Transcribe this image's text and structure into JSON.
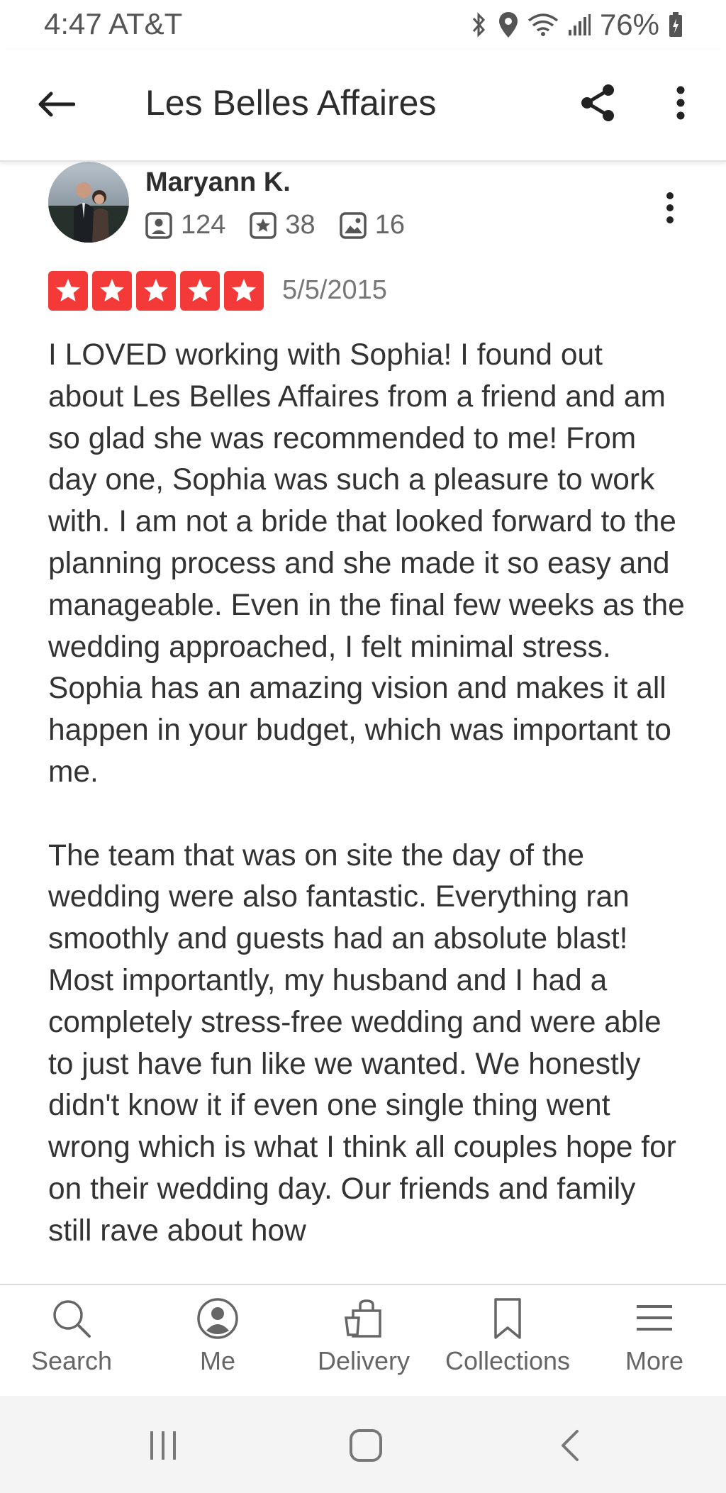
{
  "status_bar": {
    "time": "4:47",
    "carrier": "AT&T",
    "battery": "76%"
  },
  "header": {
    "title": "Les Belles Affaires"
  },
  "review": {
    "reviewer_name": "Maryann K.",
    "friends_count": "124",
    "reviews_count": "38",
    "photos_count": "16",
    "rating": 5,
    "date": "5/5/2015",
    "paragraphs": [
      "I LOVED working with Sophia! I found out about Les Belles Affaires from a friend and am so glad she was recommended to me! From day one, Sophia was such a pleasure to work with. I am not a bride that looked forward to the planning process and she made it so easy and manageable. Even in the final few weeks as the wedding approached, I felt minimal stress. Sophia has an amazing vision and makes it all happen in your budget, which was important to me.",
      "The team that was on site the day of the wedding were also fantastic. Everything ran smoothly and guests had an absolute blast! Most importantly, my husband and I had a completely stress-free wedding and were able to just have fun like we wanted. We honestly didn't know it if even one single thing went wrong which is what I think all couples hope for on their wedding day. Our friends and family still rave about how"
    ]
  },
  "bottom_nav": {
    "items": [
      {
        "label": "Search",
        "icon": "search-icon"
      },
      {
        "label": "Me",
        "icon": "profile-icon"
      },
      {
        "label": "Delivery",
        "icon": "delivery-bag-icon"
      },
      {
        "label": "Collections",
        "icon": "bookmark-icon"
      },
      {
        "label": "More",
        "icon": "menu-icon"
      }
    ]
  },
  "colors": {
    "star_red": "#f43939",
    "text_dark": "#333333",
    "text_muted": "#666666"
  }
}
